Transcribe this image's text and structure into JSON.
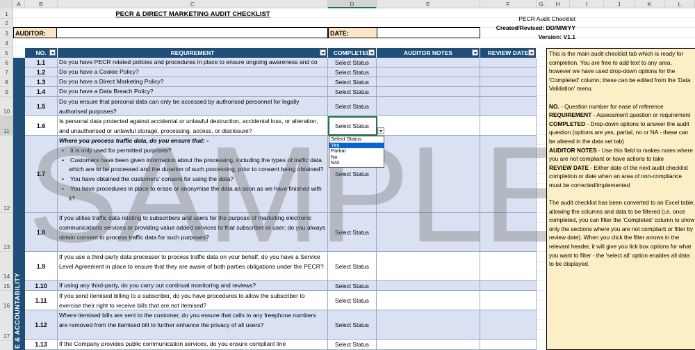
{
  "colors": {
    "header_bg": "#1f4e79",
    "row_alt": "#d9e1f2",
    "row_plain": "#ffffff",
    "label_bg": "#fbe5c7",
    "notes_bg": "#fcefc6",
    "dropdown_highlight": "#0a64d2",
    "selection": "#217346"
  },
  "sheet": {
    "columns": [
      "A",
      "B",
      "C",
      "D",
      "E",
      "F",
      "G",
      "H",
      "I",
      "J",
      "K",
      "L"
    ],
    "selected_column": "D",
    "rows": [
      "1",
      "2",
      "3",
      "4",
      "5",
      "6",
      "7",
      "8",
      "9",
      "10",
      "11",
      "12",
      "13",
      "14",
      "15",
      "16",
      "17"
    ],
    "selected_row": "11"
  },
  "header": {
    "title": "PECR & DIRECT MARKETING AUDIT CHECKLIST",
    "doc_name": "PECR Audit Checklist",
    "created": "Created/Revised: DD/MM/YY",
    "version": "Version: V1.1",
    "auditor_label": "AUDITOR:",
    "auditor_value": "",
    "date_label": "DATE:",
    "date_value": ""
  },
  "table": {
    "columns": [
      "NO.",
      "REQUIREMENT",
      "COMPLETED",
      "AUDITOR NOTES",
      "REVIEW DATE"
    ],
    "rows": [
      {
        "no": "1.1",
        "status": "Select Status",
        "text": "Do you have PECR related policies and procedures in place to ensure ongoing awareness and co"
      },
      {
        "no": "1.2",
        "status": "Select Status",
        "text": "Do you have a Cookie Policy?"
      },
      {
        "no": "1.3",
        "status": "Select Status",
        "text": "Do you have a Direct Marketing Policy?"
      },
      {
        "no": "1.4",
        "status": "Select Status",
        "text": "Do you have a Data Breach Policy?"
      },
      {
        "no": "1.5",
        "status": "Select Status",
        "text": "Do you ensure that personal data can only be accessed by authorised personnel for legally authorised purposes?"
      },
      {
        "no": "1.6",
        "status": "Select Status",
        "text": "Is personal data protected against accidental or unlawful destruction, accidental loss, or alteration, and unauthorised or unlawful storage, processing, access, or disclosure?"
      },
      {
        "no": "1.7",
        "status": "Select Status",
        "lead": "Where you process traffic data, do you ensure that: -",
        "bullets": [
          "It is only used for permitted purposes?",
          "Customers have been given information about the processing, including the types of traffic data which are to be processed and the duration of such processing, prior to consent being obtained?",
          "You have obtained the customers' consent for using the data?",
          "You have procedures in place to erase or anonymise the data as soon as we have finished with it?"
        ]
      },
      {
        "no": "1.8",
        "status": "Select Status",
        "text": "If you utilise traffic data relating to subscribers and users for the purpose of marketing electronic communications services or providing value added services to that subscriber or user; do you always obtain consent to process traffic data for such purposes?"
      },
      {
        "no": "1.9",
        "status": "Select Status",
        "text": "If you use a third-party data processor to process traffic data on your behalf, do you have a Service Level Agreement in place to ensure that they are aware of both parties obligations under the PECR?"
      },
      {
        "no": "1.10",
        "status": "Select Status",
        "text": "If using any third-party, do you carry out continual monitoring and reviews?"
      },
      {
        "no": "1.11",
        "status": "Select Status",
        "text": "If you send itemised billing to a subscriber, do you have procedures to allow the subscriber to exercise their right to receive bills that are not itemised?"
      },
      {
        "no": "1.12",
        "status": "Select Status",
        "text": "Where itemised bills are sent to the customer, do you ensure that calls to any freephone numbers are removed from the itemised bill to further enhance the privacy of all users?"
      },
      {
        "no": "1.13",
        "status": "Select Status",
        "text": "If the Company provides public communication services, do you ensure compliant line"
      }
    ]
  },
  "section_label": "E & ACCOUNTABILITY",
  "dropdown": {
    "options": [
      "Select Status",
      "Yes",
      "Partial",
      "No",
      "N/A"
    ],
    "highlighted": "Yes"
  },
  "notes": {
    "intro": "This is the main audit checklist tab which is ready for completion. You are free to add text to any area, however we have used drop-down options for the 'Completed' column; these can be edited from the 'Data Validation' menu.",
    "items": [
      {
        "term": "NO.",
        "desc": " - Question number for ease of reference"
      },
      {
        "term": "REQUIREMENT",
        "desc": " - Assessment question or requirement"
      },
      {
        "term": "COMPLETED",
        "desc": " - Drop-down options to answer the audit question (options are yes, partial, no or NA - these can be altered in the data set tab)"
      },
      {
        "term": "AUDITOR NOTES",
        "desc": " - Use this field to makes notes where you are not compliant or have actions to take"
      },
      {
        "term": "REVIEW DATE",
        "desc": " - Either date of the next audit checklist completion or date when an area of non-compliance must be corrected/implemented"
      }
    ],
    "outro": "The audit checklist has been converted to an Excel table, allowing the columns and data to be filtered (i.e. once completed, you can filter the 'Completed' column to show only the sections where you are not compliant or filter by review date). When you click the filter arrows in the relevant header, it will give you tick box options for what you want to filter - the 'select all' option enables all data to be displayed."
  },
  "watermark": "SAMPLE"
}
